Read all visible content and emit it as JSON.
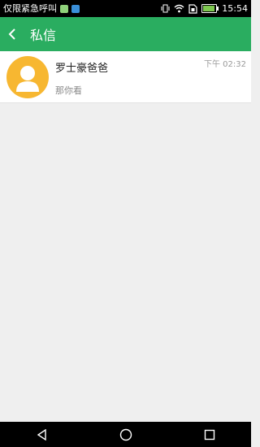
{
  "status_bar": {
    "carrier_text": "仅限紧急呼叫",
    "time": "15:54",
    "notification_icons": [
      "app-notification-icon",
      "app-notification-icon"
    ]
  },
  "app_bar": {
    "title": "私信",
    "color": "#2aad60",
    "back_icon": "back-arrow-icon"
  },
  "messages": [
    {
      "name": "罗士豪爸爸",
      "time": "下午 02:32",
      "preview": "那你看",
      "avatar_color": "#f7b731",
      "avatar_icon": "person-icon"
    }
  ],
  "nav_bar": {
    "buttons": [
      "back-triangle-icon",
      "home-circle-icon",
      "recents-square-icon"
    ]
  }
}
